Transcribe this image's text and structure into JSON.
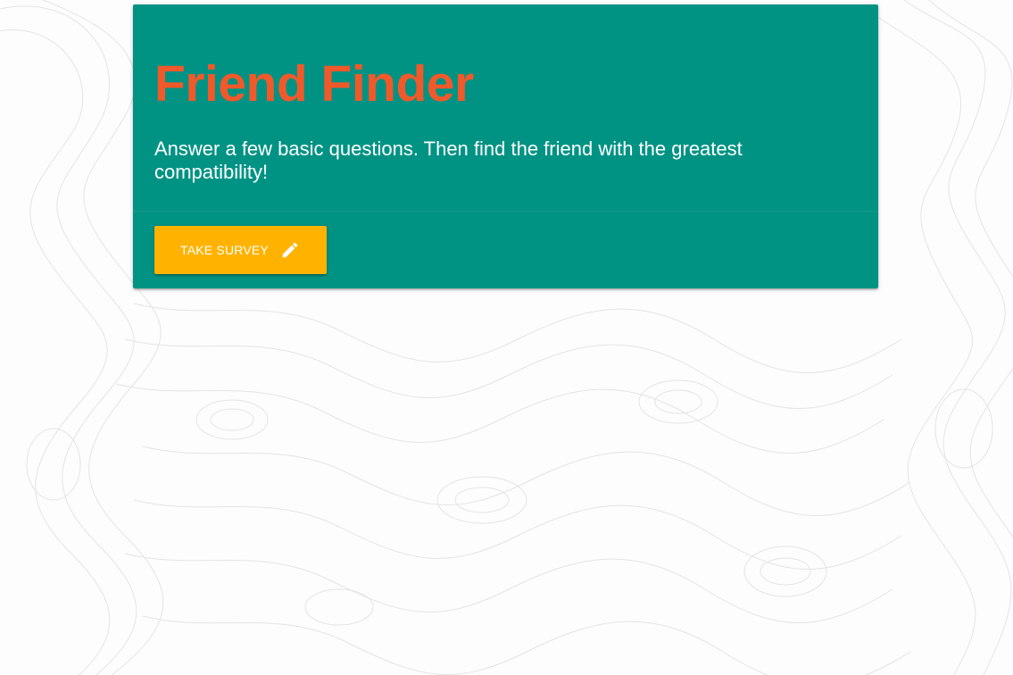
{
  "page": {
    "background_color": "#fdfdfd",
    "pattern_color": "#e4e4e4"
  },
  "card": {
    "background_color": "#009384",
    "title": "Friend Finder",
    "title_color": "#f0592a",
    "description": "Answer a few basic questions. Then find the friend with the greatest compatibility!",
    "description_color": "#ffffff"
  },
  "action": {
    "button_label": "TAKE SURVEY",
    "button_color": "#ffb300",
    "button_icon": "pencil-icon"
  }
}
